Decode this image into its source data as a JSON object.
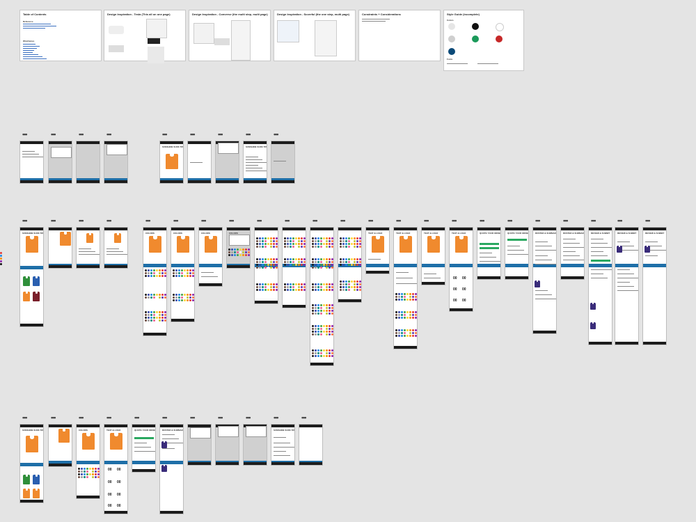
{
  "boards": [
    {
      "title": "Table of Contents"
    },
    {
      "title": "Design Inspiration - Tesla (This all on one page)"
    },
    {
      "title": "Design Inspiration - Converse (the multi step, multi page)"
    },
    {
      "title": "Design Inspiration - Scoreful (the one step, multi page)"
    },
    {
      "title": "Constraints + Considerations"
    },
    {
      "title": "Style Guide (incomplete)"
    }
  ],
  "toc": {
    "heading1": "Reference",
    "heading2": "Wireframes"
  },
  "style_guide": {
    "colors_label": "Colors",
    "fonts_label": "Fonts",
    "colors": [
      "#e6e6e6",
      "#111111",
      "#ffffff",
      "#cfcfcf",
      "#1b9a5a",
      "#c62828",
      "#0b4a78"
    ]
  },
  "frame_headings": {
    "product": "SUNSHINE SUNS TRUE SMITHSONIAN",
    "colors": "COLORS",
    "text_logo": "TEXT & LOGO",
    "quote": "QUOTE YOUR ORDER",
    "roster": "ROSTER & SUMMARY",
    "review": "REVIEW & SUBMIT"
  },
  "jersey_numbers": [
    "00",
    "00"
  ],
  "swatch_colors": [
    "#1b1b1b",
    "#3949ab",
    "#1e88e5",
    "#43a047",
    "#fdd835",
    "#fb8c00",
    "#e53935",
    "#8e24aa",
    "#6d4c41",
    "#9e9e9e",
    "#00897b",
    "#f06292",
    "#ffffff",
    "#c0ca33",
    "#5e35b1",
    "#ff7043"
  ]
}
